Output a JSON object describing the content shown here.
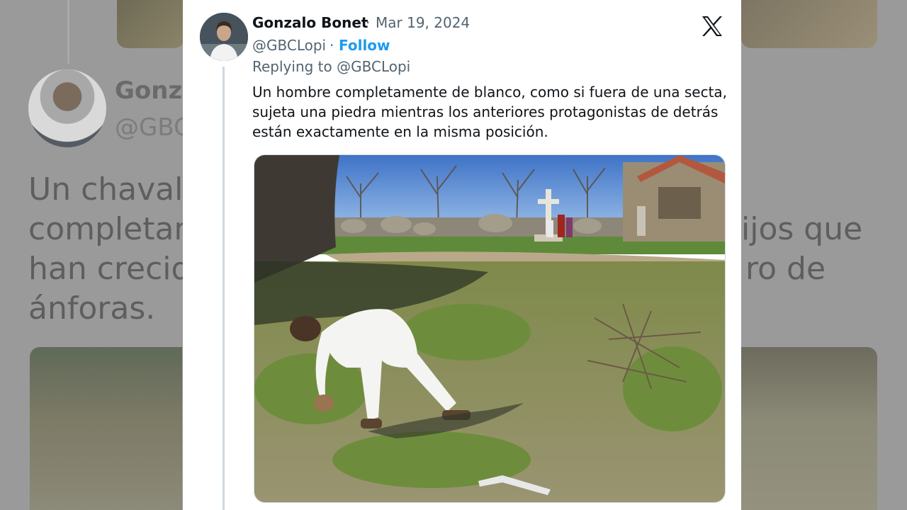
{
  "background": {
    "name": "Gonza",
    "handle": "@GBC",
    "text_lines": [
      "Un chaval",
      "completam",
      "han crecid",
      "ánforas."
    ],
    "text_right": [
      "ijos que",
      "ro de"
    ]
  },
  "tweet": {
    "author_name": "Gonzalo Bonet",
    "separator": "·",
    "date": "Mar 19, 2024",
    "handle": "@GBCLopi",
    "follow_label": "Follow",
    "replying_to": "Replying to @GBCLopi",
    "text_lines": [
      "Un hombre completamente de blanco, como si fuera de una secta,",
      "sujeta una piedra mientras los anteriores protagonistas de detrás",
      "están exactamente en la misma posición."
    ]
  },
  "icons": {
    "logo": "x-logo-icon",
    "avatar": "avatar"
  },
  "colors": {
    "link_blue": "#1d9bf0",
    "text_primary": "#0f1419",
    "text_secondary": "#536471",
    "thread_line": "#cfd9de"
  }
}
